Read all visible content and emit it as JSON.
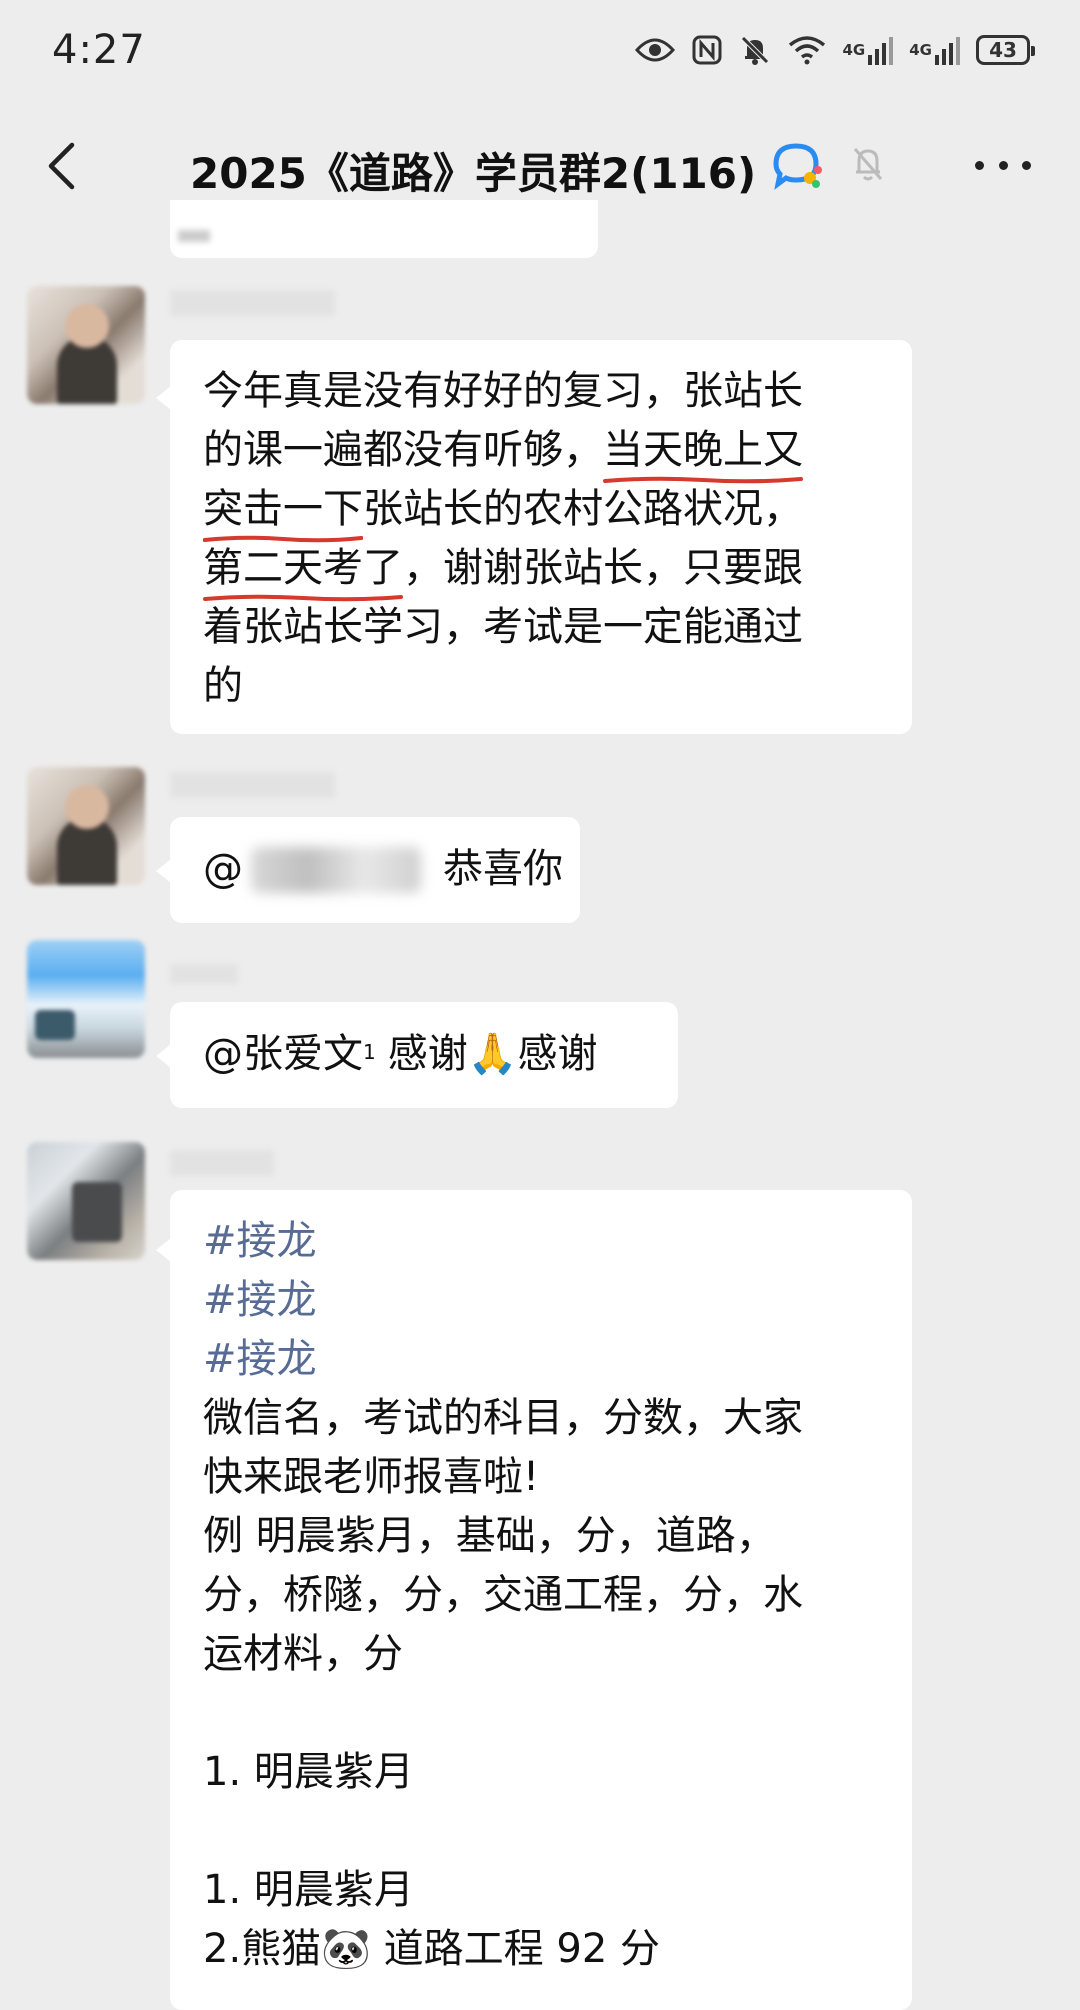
{
  "status_bar": {
    "time": "4:27",
    "net1": "4G",
    "net2": "4G",
    "battery": "43",
    "icons": [
      "eye-icon",
      "nfc-icon",
      "bell-off-icon",
      "wifi-icon",
      "signal-icon",
      "signal-icon",
      "battery-icon"
    ]
  },
  "nav": {
    "title": "2025《道路》学员群2(116)",
    "icons": [
      "back-icon",
      "chat-badge-icon",
      "mute-icon",
      "more-icon"
    ]
  },
  "messages": [
    {
      "id": 1,
      "lines": [
        [
          {
            "t": "今年真是没有好好的复习，张站长"
          }
        ],
        [
          {
            "t": "的课一遍都没有听够，"
          },
          {
            "t": "当天晚上又",
            "u": true
          }
        ],
        [
          {
            "t": "突击一下",
            "u": true
          },
          {
            "t": "张站长的农村公路状况，"
          }
        ],
        [
          {
            "t": "第二天考了",
            "u": true
          },
          {
            "t": "，谢谢张站长，只要跟"
          }
        ],
        [
          {
            "t": "着张站长学习，考试是一定能通过"
          }
        ],
        [
          {
            "t": "的"
          }
        ]
      ]
    },
    {
      "id": 2,
      "prefix": "@",
      "text": "恭喜你"
    },
    {
      "id": 3,
      "mention": "@张爱文",
      "sup": "1",
      "text_a": "感谢",
      "emoji": "🙏",
      "text_b": "感谢"
    },
    {
      "id": 4,
      "hashtags": [
        "#接龙",
        "#接龙",
        "#接龙"
      ],
      "body": [
        "微信名，考试的科目，分数，大家",
        "快来跟老师报喜啦!",
        "例 明晨紫月，基础，分，道路，",
        "分，桥隧，分，交通工程，分，水",
        "运材料，分",
        "",
        "1. 明晨紫月",
        "",
        "1. 明晨紫月",
        "2.熊猫🐼  道路工程 92 分"
      ]
    }
  ],
  "colors": {
    "background": "#ededed",
    "bubble": "#ffffff",
    "hashtag": "#576b95",
    "underline": "#d63a2e"
  }
}
